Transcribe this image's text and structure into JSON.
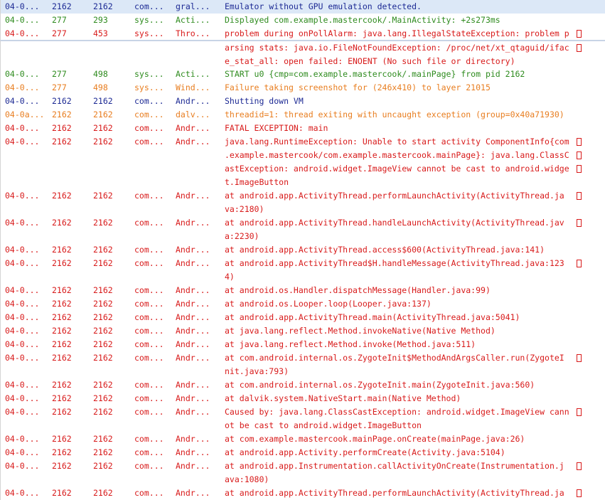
{
  "colors": {
    "debug": "#1d2a94",
    "info": "#2e8b1e",
    "warn": "#e87d1f",
    "error": "#d81a1a",
    "selection": "#dce8f7"
  },
  "icons": {
    "wrap": "line-wrap-marker-icon"
  },
  "rows": [
    {
      "level": "D",
      "date": "04-0...",
      "pid": "2162",
      "tid": "2162",
      "app": "com...",
      "tag": "gral...",
      "lines": [
        "Emulator without GPU emulation detected."
      ],
      "selected": true
    },
    {
      "level": "I",
      "date": "04-0...",
      "pid": "277",
      "tid": "293",
      "app": "sys...",
      "tag": "Acti...",
      "lines": [
        "Displayed com.example.mastercook/.MainActivity: +2s273ms"
      ]
    },
    {
      "level": "E",
      "date": "04-0...",
      "pid": "277",
      "tid": "453",
      "app": "sys...",
      "tag": "Thro...",
      "lines": [
        "problem during onPollAlarm: java.lang.IllegalStateException: problem p",
        "arsing stats: java.io.FileNotFoundException: /proc/net/xt_qtaguid/ifac",
        "e_stat_all: open failed: ENOENT (No such file or directory)"
      ],
      "separator_after_first": true
    },
    {
      "level": "I",
      "date": "04-0...",
      "pid": "277",
      "tid": "498",
      "app": "sys...",
      "tag": "Acti...",
      "lines": [
        "START u0 {cmp=com.example.mastercook/.mainPage} from pid 2162"
      ]
    },
    {
      "level": "W",
      "date": "04-0...",
      "pid": "277",
      "tid": "498",
      "app": "sys...",
      "tag": "Wind...",
      "lines": [
        "Failure taking screenshot for (246x410) to layer 21015"
      ]
    },
    {
      "level": "D",
      "date": "04-0...",
      "pid": "2162",
      "tid": "2162",
      "app": "com...",
      "tag": "Andr...",
      "lines": [
        "Shutting down VM"
      ]
    },
    {
      "level": "W",
      "date": "04-0a...",
      "pid": "2162",
      "tid": "2162",
      "app": "com...",
      "tag": "dalv...",
      "lines": [
        "threadid=1: thread exiting with uncaught exception (group=0x40a71930)"
      ]
    },
    {
      "level": "E",
      "date": "04-0...",
      "pid": "2162",
      "tid": "2162",
      "app": "com...",
      "tag": "Andr...",
      "lines": [
        "FATAL EXCEPTION: main"
      ]
    },
    {
      "level": "E",
      "date": "04-0...",
      "pid": "2162",
      "tid": "2162",
      "app": "com...",
      "tag": "Andr...",
      "lines": [
        "java.lang.RuntimeException: Unable to start activity ComponentInfo{com",
        ".example.mastercook/com.example.mastercook.mainPage}: java.lang.ClassC",
        "astException: android.widget.ImageView cannot be cast to android.widge",
        "t.ImageButton"
      ]
    },
    {
      "level": "E",
      "date": "04-0...",
      "pid": "2162",
      "tid": "2162",
      "app": "com...",
      "tag": "Andr...",
      "lines": [
        "at android.app.ActivityThread.performLaunchActivity(ActivityThread.ja",
        "va:2180)"
      ]
    },
    {
      "level": "E",
      "date": "04-0...",
      "pid": "2162",
      "tid": "2162",
      "app": "com...",
      "tag": "Andr...",
      "lines": [
        "at android.app.ActivityThread.handleLaunchActivity(ActivityThread.jav",
        "a:2230)"
      ]
    },
    {
      "level": "E",
      "date": "04-0...",
      "pid": "2162",
      "tid": "2162",
      "app": "com...",
      "tag": "Andr...",
      "lines": [
        "at android.app.ActivityThread.access$600(ActivityThread.java:141)"
      ]
    },
    {
      "level": "E",
      "date": "04-0...",
      "pid": "2162",
      "tid": "2162",
      "app": "com...",
      "tag": "Andr...",
      "lines": [
        "at android.app.ActivityThread$H.handleMessage(ActivityThread.java:123",
        "4)"
      ]
    },
    {
      "level": "E",
      "date": "04-0...",
      "pid": "2162",
      "tid": "2162",
      "app": "com...",
      "tag": "Andr...",
      "lines": [
        "at android.os.Handler.dispatchMessage(Handler.java:99)"
      ]
    },
    {
      "level": "E",
      "date": "04-0...",
      "pid": "2162",
      "tid": "2162",
      "app": "com...",
      "tag": "Andr...",
      "lines": [
        "at android.os.Looper.loop(Looper.java:137)"
      ]
    },
    {
      "level": "E",
      "date": "04-0...",
      "pid": "2162",
      "tid": "2162",
      "app": "com...",
      "tag": "Andr...",
      "lines": [
        "at android.app.ActivityThread.main(ActivityThread.java:5041)"
      ]
    },
    {
      "level": "E",
      "date": "04-0...",
      "pid": "2162",
      "tid": "2162",
      "app": "com...",
      "tag": "Andr...",
      "lines": [
        "at java.lang.reflect.Method.invokeNative(Native Method)"
      ]
    },
    {
      "level": "E",
      "date": "04-0...",
      "pid": "2162",
      "tid": "2162",
      "app": "com...",
      "tag": "Andr...",
      "lines": [
        "at java.lang.reflect.Method.invoke(Method.java:511)"
      ]
    },
    {
      "level": "E",
      "date": "04-0...",
      "pid": "2162",
      "tid": "2162",
      "app": "com...",
      "tag": "Andr...",
      "lines": [
        "at com.android.internal.os.ZygoteInit$MethodAndArgsCaller.run(ZygoteI",
        "nit.java:793)"
      ]
    },
    {
      "level": "E",
      "date": "04-0...",
      "pid": "2162",
      "tid": "2162",
      "app": "com...",
      "tag": "Andr...",
      "lines": [
        "at com.android.internal.os.ZygoteInit.main(ZygoteInit.java:560)"
      ]
    },
    {
      "level": "E",
      "date": "04-0...",
      "pid": "2162",
      "tid": "2162",
      "app": "com...",
      "tag": "Andr...",
      "lines": [
        "at dalvik.system.NativeStart.main(Native Method)"
      ]
    },
    {
      "level": "E",
      "date": "04-0...",
      "pid": "2162",
      "tid": "2162",
      "app": "com...",
      "tag": "Andr...",
      "lines": [
        "Caused by: java.lang.ClassCastException: android.widget.ImageView cann",
        "ot be cast to android.widget.ImageButton"
      ]
    },
    {
      "level": "E",
      "date": "04-0...",
      "pid": "2162",
      "tid": "2162",
      "app": "com...",
      "tag": "Andr...",
      "lines": [
        "at com.example.mastercook.mainPage.onCreate(mainPage.java:26)"
      ]
    },
    {
      "level": "E",
      "date": "04-0...",
      "pid": "2162",
      "tid": "2162",
      "app": "com...",
      "tag": "Andr...",
      "lines": [
        "at android.app.Activity.performCreate(Activity.java:5104)"
      ]
    },
    {
      "level": "E",
      "date": "04-0...",
      "pid": "2162",
      "tid": "2162",
      "app": "com...",
      "tag": "Andr...",
      "lines": [
        "at android.app.Instrumentation.callActivityOnCreate(Instrumentation.j",
        "ava:1080)"
      ]
    },
    {
      "level": "E",
      "date": "04-0...",
      "pid": "2162",
      "tid": "2162",
      "app": "com...",
      "tag": "Andr...",
      "lines": [
        "at android.app.ActivityThread.performLaunchActivity(ActivityThread.ja"
      ],
      "continues": true
    }
  ]
}
